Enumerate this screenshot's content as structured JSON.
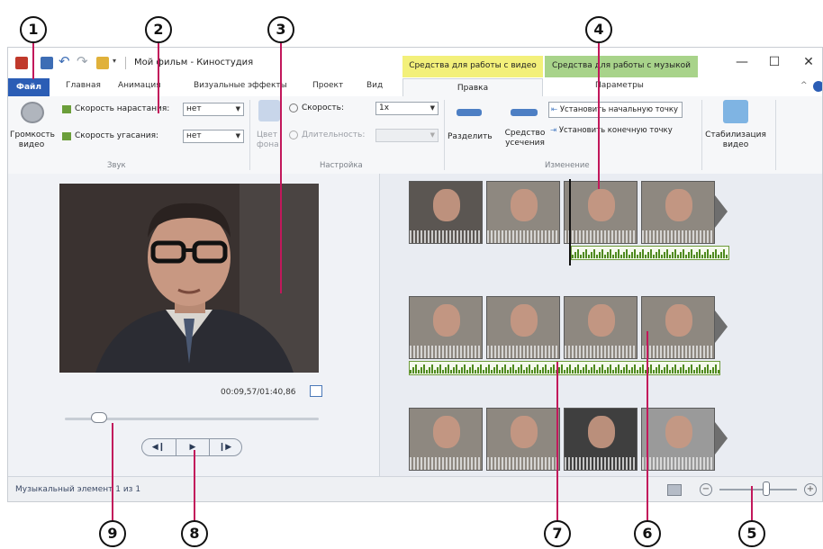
{
  "window": {
    "title": "Мой фильм - Киностудия",
    "context_tab_video": "Средства для работы с видео",
    "context_tab_music": "Средства для работы с музыкой"
  },
  "tabs": {
    "file": "Файл",
    "home": "Главная",
    "animation": "Анимация",
    "effects": "Визуальные эффекты",
    "project": "Проект",
    "view": "Вид",
    "edit": "Правка",
    "options": "Параметры"
  },
  "ribbon": {
    "video_volume": "Громкость видео",
    "fade_in_label": "Скорость нарастания:",
    "fade_in_value": "нет",
    "fade_out_label": "Скорость угасания:",
    "fade_out_value": "нет",
    "group_audio": "Звук",
    "bg_color": "Цвет фона",
    "speed_label": "Скорость:",
    "speed_value": "1x",
    "duration_label": "Длительность:",
    "duration_value": "",
    "group_settings": "Настройка",
    "split": "Разделить",
    "trim_tool": "Средство усечения",
    "set_start": "Установить начальную точку",
    "set_end": "Установить конечную точку",
    "group_edit": "Изменение",
    "stabilization": "Стабилизация видео"
  },
  "preview": {
    "timecode": "00:09,57/01:40,86",
    "seek_fraction": 0.1
  },
  "status": {
    "text": "Музыкальный элемент 1 из 1"
  },
  "zoom": {
    "level_fraction": 0.6
  },
  "callouts": [
    "1",
    "2",
    "3",
    "4",
    "5",
    "6",
    "7",
    "8",
    "9"
  ],
  "colors": {
    "accent": "#2b5db5",
    "video_tools": "#f3f07a",
    "music_tools": "#a8d38a",
    "leader": "#c2185b"
  },
  "icons": {
    "app": "film-app-icon",
    "save": "save-icon",
    "undo": "undo-icon",
    "redo": "redo-icon",
    "volume": "speaker-icon",
    "split": "split-icon",
    "trim": "trim-icon",
    "stabilize": "stabilization-icon",
    "play": "play-icon"
  }
}
